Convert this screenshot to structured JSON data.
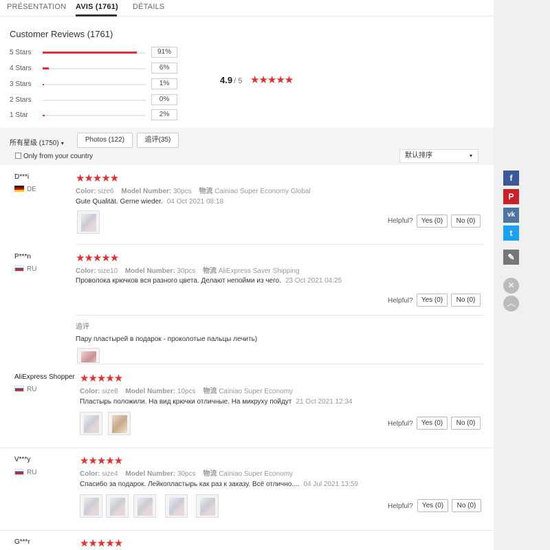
{
  "tabs": [
    {
      "label": "PRÉSENTATION"
    },
    {
      "label": "AVIS  (1761)"
    },
    {
      "label": "DÉTAILS"
    }
  ],
  "summary": {
    "title": "Customer Reviews (1761)",
    "distribution": [
      {
        "label": "5 Stars",
        "pct": "91%",
        "fill": 0.91
      },
      {
        "label": "4 Stars",
        "pct": "6%",
        "fill": 0.06
      },
      {
        "label": "3 Stars",
        "pct": "1%",
        "fill": 0.01
      },
      {
        "label": "2 Stars",
        "pct": "0%",
        "fill": 0.0
      },
      {
        "label": "1 Star",
        "pct": "2%",
        "fill": 0.02
      }
    ],
    "average": "4.9",
    "average_of": "/ 5",
    "average_stars": "★★★★★"
  },
  "filters": {
    "rating_select": "所有星级 (1750)",
    "photos_button": "Photos (122)",
    "followup_button": "追评(35)",
    "only_country_label": "Only from your country",
    "sort_select": "默认排序"
  },
  "reviews": [
    {
      "user": "D***i",
      "country": "DE",
      "stars": "★★★★★",
      "color_label": "Color:",
      "color_value": "size6",
      "model_label": "Model Number:",
      "model_value": "30pcs",
      "shipping_label": "物流",
      "shipping_value": "Cainiao Super Economy Global",
      "text": "Gute Qualität. Gerne wieder.",
      "date": "04 Oct 2021 08:18",
      "helpful_label": "Helpful?",
      "yes_label": "Yes (0)",
      "no_label": "No (0)"
    },
    {
      "user": "P***n",
      "country": "RU",
      "stars": "★★★★★",
      "color_label": "Color:",
      "color_value": "size10",
      "model_label": "Model Number:",
      "model_value": "30pcs",
      "shipping_label": "物流",
      "shipping_value": "AliExpress Saver Shipping",
      "text": "Проволока крючков вся разного цвета. Делают непойми из чего.",
      "date": "23 Oct 2021 04:25",
      "helpful_label": "Helpful?",
      "yes_label": "Yes (0)",
      "no_label": "No (0)",
      "followup_label": "追评",
      "followup_text": "Пару пластырей в подарок - проколотые пальцы лечить)"
    },
    {
      "user": "AliExpress Shopper",
      "country": "RU",
      "stars": "★★★★★",
      "color_label": "Color:",
      "color_value": "size8",
      "model_label": "Model Number:",
      "model_value": "10pcs",
      "shipping_label": "物流",
      "shipping_value": "Cainiao Super Economy",
      "text": "Пластырь положили. На вид крючки отличные. На микруху пойдут",
      "date": "21 Oct 2021 12:34",
      "helpful_label": "Helpful?",
      "yes_label": "Yes (0)",
      "no_label": "No (0)"
    },
    {
      "user": "V***y",
      "country": "RU",
      "stars": "★★★★★",
      "color_label": "Color:",
      "color_value": "size4",
      "model_label": "Model Number:",
      "model_value": "30pcs",
      "shipping_label": "物流",
      "shipping_value": "Cainiao Super Economy",
      "text": "Спасибо за подарок. Лейкопластырь как раз к заказу. Всё отлично....",
      "date": "04 Jul 2021 13:59",
      "helpful_label": "Helpful?",
      "yes_label": "Yes (0)",
      "no_label": "No (0)"
    },
    {
      "user": "G***r",
      "stars": "★★★★★"
    }
  ],
  "share": {
    "facebook_glyph": "f",
    "pinterest_glyph": "P",
    "vk_glyph": "vk",
    "twitter_glyph": "t",
    "edit_glyph": "✎",
    "close_glyph": "✕",
    "up_glyph": "︿"
  },
  "colors": {
    "accent_red": "#e62e2e",
    "facebook": "#3b5998",
    "pinterest": "#cb2027",
    "vk": "#4c75a3",
    "twitter": "#1da1f2"
  }
}
